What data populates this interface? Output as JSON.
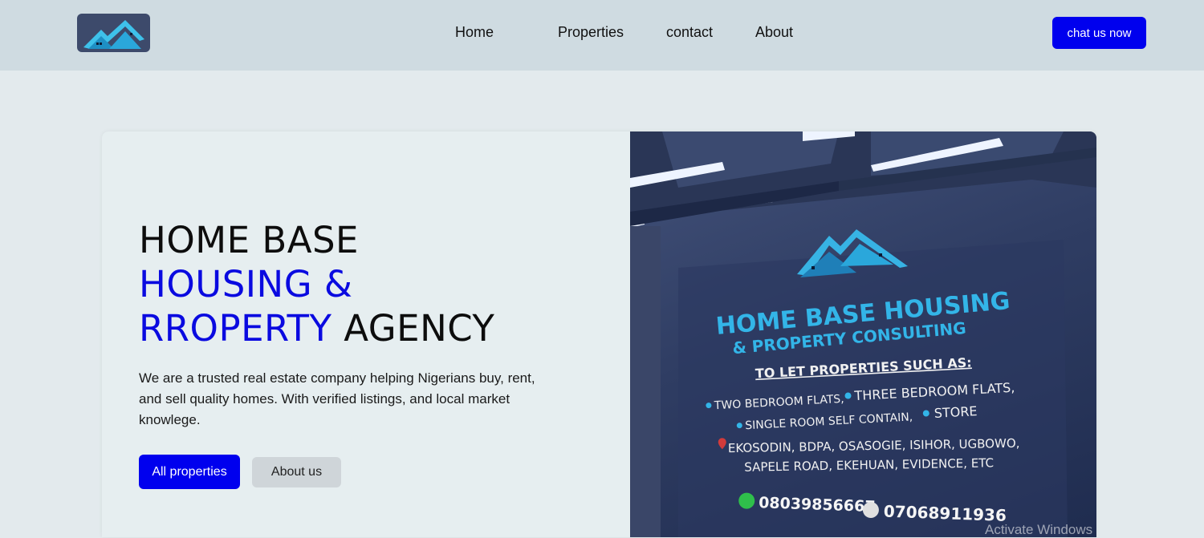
{
  "nav": {
    "links": [
      "Home",
      "Properties",
      "contact",
      "About"
    ],
    "cta_label": "chat us now"
  },
  "hero": {
    "title_line1": "HOME BASE",
    "title_line2": "HOUSING &",
    "title_line3_accent": "RROPERTY",
    "title_line3_rest": " AGENCY",
    "description": "We are a trusted real estate company helping Nigerians buy, rent, and sell quality homes. With verified listings, and local market knowlege.",
    "primary_button": "All properties",
    "secondary_button": "About us"
  },
  "sign": {
    "line1": "HOME BASE HOUSING",
    "line2": "& PROPERTY CONSULTING",
    "heading": "TO LET PROPERTIES SUCH AS:",
    "item1": "TWO BEDROOM FLATS,",
    "item2": "THREE BEDROOM FLATS,",
    "item3": "SINGLE ROOM SELF CONTAIN,",
    "item4": "STORE",
    "locations1": "EKOSODIN, BDPA, OSASOGIE, ISIHOR, UGBOWO,",
    "locations2": "SAPELE ROAD, EKEHUAN, EVIDENCE, ETC",
    "phone1": "08039856667",
    "phone2": "07068911936"
  },
  "watermark": "Activate Windows",
  "colors": {
    "accent": "#0000ee",
    "navbar_bg": "#cfdbe1",
    "page_bg": "#e3eaed",
    "sign_cyan": "#2bb8e8"
  }
}
